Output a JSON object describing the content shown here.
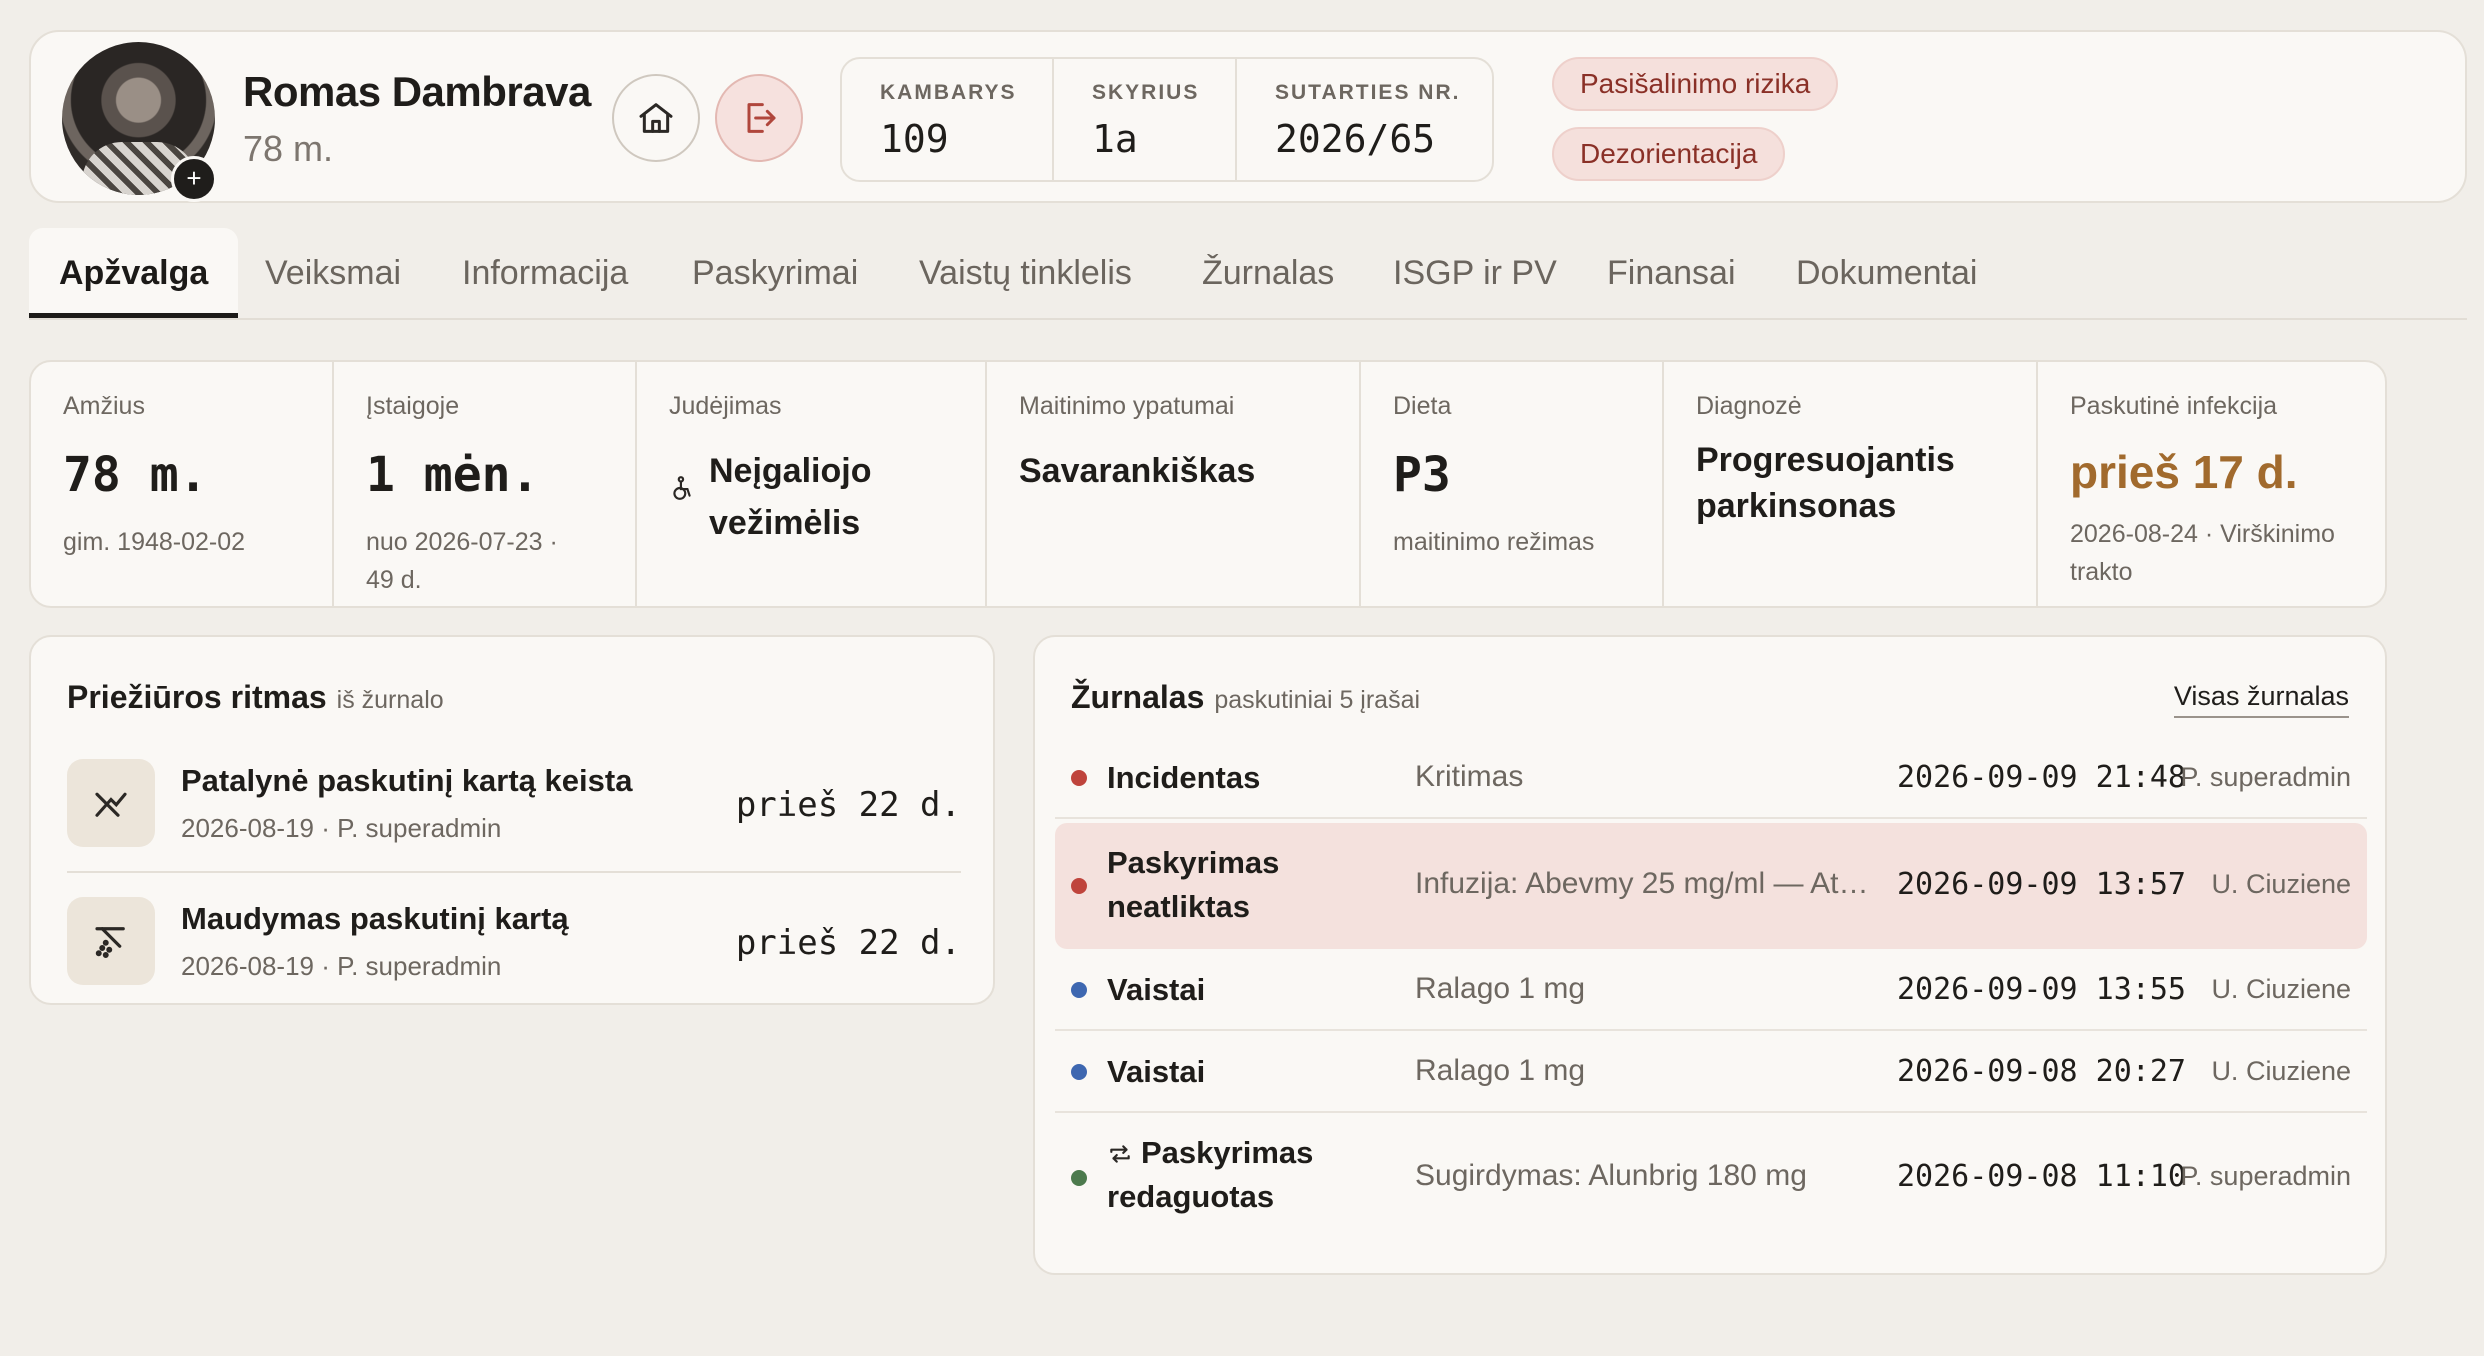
{
  "patient": {
    "name": "Romas Dambrava",
    "age": "78 m.",
    "add_symbol": "+",
    "info": [
      {
        "label": "KAMBARYS",
        "value": "109"
      },
      {
        "label": "SKYRIUS",
        "value": "1a"
      },
      {
        "label": "SUTARTIES NR.",
        "value": "2026/65"
      }
    ],
    "tags": [
      "Pasišalinimo rizika",
      "Dezorientacija"
    ]
  },
  "icons": {
    "home": "home-icon",
    "exit": "logout-icon",
    "wheelchair": "wheelchair-icon",
    "bedding": "bedding-icon",
    "shower": "shower-icon",
    "edit": "repeat-icon"
  },
  "colors": {
    "accent_warn": "#a16a2d",
    "dot_red": "#bf443c",
    "dot_blue": "#3e67b0",
    "dot_green": "#4c7a4d",
    "highlight": "#f4e1dd",
    "tag_text": "#8a3027"
  },
  "tabs": [
    "Apžvalga",
    "Veiksmai",
    "Informacija",
    "Paskyrimai",
    "Vaistų tinklelis",
    "Žurnalas",
    "ISGP ir PV",
    "Finansai",
    "Dokumentai"
  ],
  "stats": {
    "age": {
      "label": "Amžius",
      "value": "78 m.",
      "sub": "gim. 1948-02-02"
    },
    "stay": {
      "label": "Įstaigoje",
      "value": "1 mėn.",
      "sub": "nuo 2026-07-23 ·",
      "sub2": "49 d."
    },
    "mobility": {
      "label": "Judėjimas",
      "line1": "Neįgaliojo",
      "line2": "vežimėlis"
    },
    "feeding": {
      "label": "Maitinimo ypatumai",
      "value": "Savarankiškas"
    },
    "diet": {
      "label": "Dieta",
      "value": "P3",
      "sub": "maitinimo režimas"
    },
    "diagnosis": {
      "label": "Diagnozė",
      "line1": "Progresuojantis",
      "line2": "parkinsonas"
    },
    "infection": {
      "label": "Paskutinė infekcija",
      "value": "prieš 17 d.",
      "sub1": "2026-08-24 · Virškinimo",
      "sub2": "trakto"
    }
  },
  "care": {
    "title": "Priežiūros ritmas",
    "subtitle": "iš žurnalo",
    "rows": [
      {
        "title": "Patalynė paskutinį kartą keista",
        "sub": "2026-08-19 · P. superadmin",
        "ago": "prieš 22 d."
      },
      {
        "title": "Maudymas paskutinį kartą",
        "sub": "2026-08-19 · P. superadmin",
        "ago": "prieš 22 d."
      }
    ]
  },
  "journal": {
    "title": "Žurnalas",
    "subtitle": "paskutiniai 5 įrašai",
    "all_link": "Visas žurnalas",
    "rows": [
      {
        "type": "Incidentas",
        "desc": "Kritimas",
        "time": "2026-09-09 21:48",
        "user": "P. superadmin"
      },
      {
        "type1": "Paskyrimas",
        "type2": "neatliktas",
        "desc": "Infuzija: Abevmy 25 mg/ml — Ats...",
        "time": "2026-09-09 13:57",
        "user": "U. Ciuziene"
      },
      {
        "type": "Vaistai",
        "desc": "Ralago 1 mg",
        "time": "2026-09-09 13:55",
        "user": "U. Ciuziene"
      },
      {
        "type": "Vaistai",
        "desc": "Ralago 1 mg",
        "time": "2026-09-08 20:27",
        "user": "U. Ciuziene"
      },
      {
        "type1": "Paskyrimas",
        "type2": "redaguotas",
        "desc": "Sugirdymas: Alunbrig 180 mg",
        "time": "2026-09-08 11:10",
        "user": "P. superadmin"
      }
    ]
  }
}
